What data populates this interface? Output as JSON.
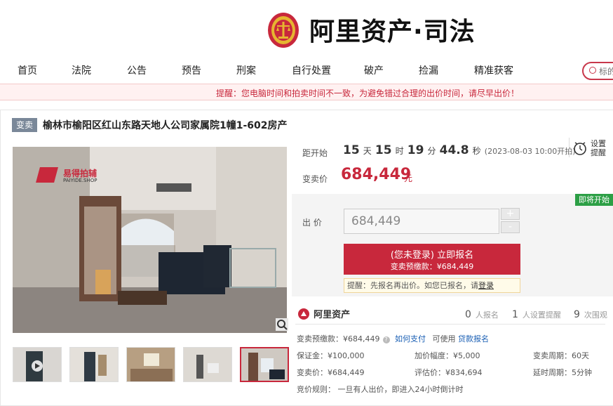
{
  "brand": {
    "name": "阿里资产·司法"
  },
  "nav": {
    "items": [
      "首页",
      "法院",
      "公告",
      "预告",
      "刑案",
      "自行处置",
      "破产",
      "捡漏",
      "精准获客"
    ]
  },
  "search": {
    "placeholder": "标的"
  },
  "notice": {
    "text": "提醒：您电脑时间和拍卖时间不一致，为避免错过合理的出价时间，请尽早出价！"
  },
  "listing": {
    "badge": "变卖",
    "title": "榆林市榆阳区红山东路天地人公司家属院1幢1-602房产",
    "watermark": {
      "main": "易得拍辅",
      "sub": "PAIYIDE.SHOP"
    }
  },
  "countdown": {
    "label": "距开始",
    "days": "15",
    "days_unit": "天",
    "hours": "15",
    "hours_unit": "时",
    "minutes": "19",
    "minutes_unit": "分",
    "seconds": "44.8",
    "seconds_unit": "秒",
    "start_note": "(2023-08-03 10:00开拍)"
  },
  "price": {
    "label": "变卖价",
    "value": "684,449",
    "unit": "元"
  },
  "remind": {
    "line1": "设置",
    "line2": "提醒"
  },
  "status_badge": "即将开始",
  "bid": {
    "label": "出 价",
    "value": "684,449",
    "plus": "+",
    "minus": "-",
    "apply_line1": "(您未登录) 立即报名",
    "apply_line2": "变卖预缴款：¥684,449",
    "tip_text": "提醒：先报名再出价。如您已报名，请",
    "tip_link": "登录"
  },
  "stats": {
    "logo": "阿里资产",
    "signups": "0",
    "signups_label": "人报名",
    "reminders": "1",
    "reminders_label": "人设置提醒",
    "views": "9",
    "views_label": "次围观"
  },
  "details": {
    "deposit": "变卖预缴款：¥684,449",
    "how_to_pay": "如何支付",
    "can_use": "可使用",
    "loan": "贷款报名",
    "bond": "保证金：¥100,000",
    "increment": "加价幅度：¥5,000",
    "period": "变卖周期：60天",
    "sale_price": "变卖价：¥684,449",
    "appraisal": "评估价：¥834,694",
    "delay": "延时周期：5分钟",
    "rule": "竞价规则：  一旦有人出价，即进入24小时倒计时"
  },
  "colors": {
    "accent": "#c8283c",
    "badge": "#7a8899",
    "green": "#2c9f45"
  }
}
